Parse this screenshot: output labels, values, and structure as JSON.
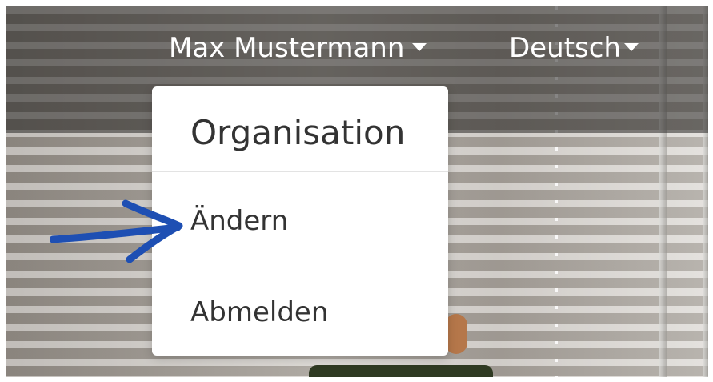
{
  "nav": {
    "user_name": "Max Mustermann",
    "language": "Deutsch"
  },
  "dropdown": {
    "header": "Organisation",
    "items": [
      {
        "label": "Ändern"
      },
      {
        "label": "Abmelden"
      }
    ]
  },
  "icons": {
    "user_caret": "caret-down-icon",
    "language_caret": "caret-down-icon",
    "annotation": "arrow-right-icon"
  },
  "colors": {
    "annotation_arrow": "#1e4fb3",
    "dropdown_text": "#333333",
    "nav_text": "#ffffff"
  }
}
